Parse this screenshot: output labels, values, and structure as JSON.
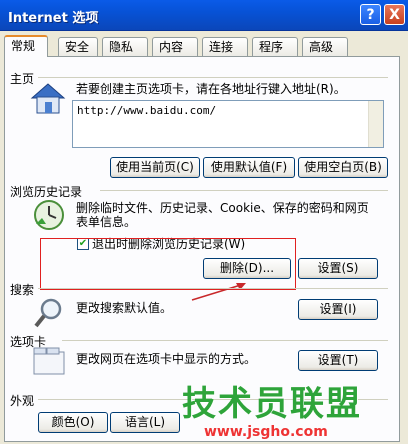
{
  "window": {
    "title": "Internet 选项",
    "help_label": "?",
    "close_label": "X"
  },
  "tabs": [
    "常规",
    "安全",
    "隐私",
    "内容",
    "连接",
    "程序",
    "高级"
  ],
  "home": {
    "label": "主页",
    "description": "若要创建主页选项卡，请在各地址行键入地址(R)。",
    "url": "http://www.baidu.com/",
    "use_current": "使用当前页(C)",
    "use_default": "使用默认值(F)",
    "use_blank": "使用空白页(B)"
  },
  "history": {
    "label": "浏览历史记录",
    "description_line1": "删除临时文件、历史记录、Cookie、保存的密码和网页",
    "description_line2": "表单信息。",
    "checkbox_label": "退出时删除浏览历史记录(W)",
    "checked": true,
    "delete_button": "删除(D)...",
    "settings_button": "设置(S)"
  },
  "search": {
    "label": "搜索",
    "description": "更改搜索默认值。",
    "settings_button": "设置(I)"
  },
  "tabs_section": {
    "label": "选项卡",
    "description": "更改网页在选项卡中显示的方式。",
    "settings_button": "设置(T)"
  },
  "appearance": {
    "label": "外观",
    "colors_button": "颜色(O)",
    "language_button": "语言(L)"
  },
  "watermark": {
    "title": "技术员联盟",
    "url": "www.jsgho.com"
  },
  "colors": {
    "titlebar": "#0752d6",
    "annotation_red": "#e02020",
    "watermark_green": "#2ea43a"
  }
}
